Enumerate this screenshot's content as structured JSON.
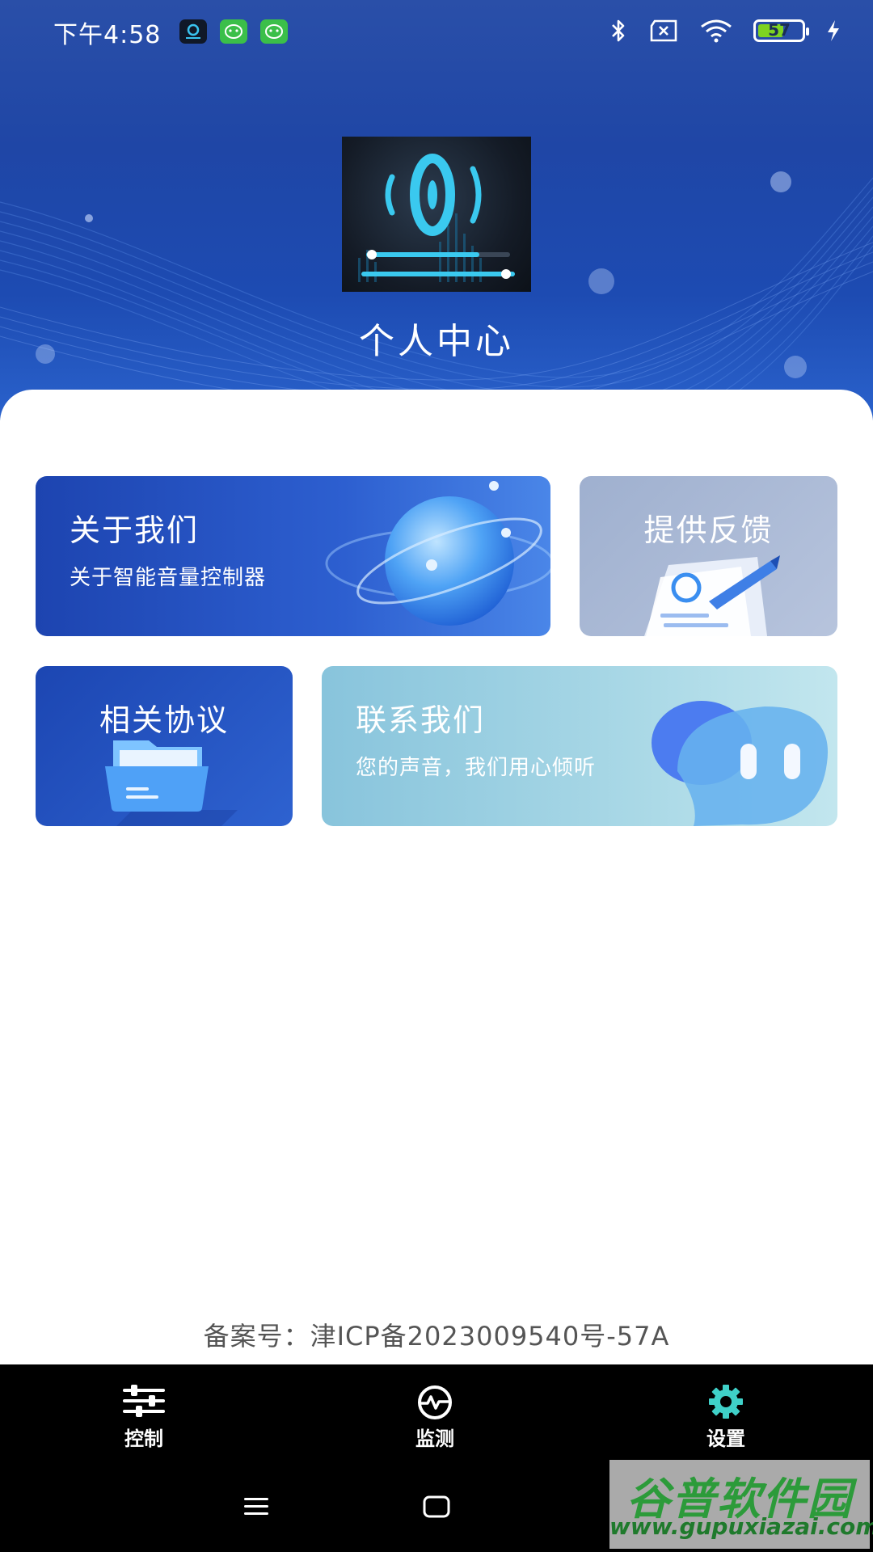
{
  "status_bar": {
    "time": "下午4:58",
    "battery_level": "57",
    "icons": [
      "app-notification-icon",
      "wechat-icon",
      "wechat-icon",
      "bluetooth-icon",
      "sim-off-icon",
      "wifi-icon",
      "battery-icon",
      "charging-icon"
    ]
  },
  "header": {
    "title": "个人中心"
  },
  "cards": {
    "about": {
      "title": "关于我们",
      "subtitle": "关于智能音量控制器"
    },
    "feedback": {
      "title": "提供反馈"
    },
    "agreement": {
      "title": "相关协议"
    },
    "contact": {
      "title": "联系我们",
      "subtitle": "您的声音，我们用心倾听"
    }
  },
  "footer": {
    "icp": "备案号：津ICP备2023009540号-57A"
  },
  "tab_bar": {
    "tabs": [
      {
        "label": "控制",
        "icon": "sliders-icon"
      },
      {
        "label": "监测",
        "icon": "monitor-icon"
      },
      {
        "label": "设置",
        "icon": "gear-icon",
        "active": true
      }
    ],
    "active_color": "#3fd0c8"
  },
  "watermark": {
    "name": "谷普软件园",
    "url": "www.gupuxiazai.com"
  }
}
